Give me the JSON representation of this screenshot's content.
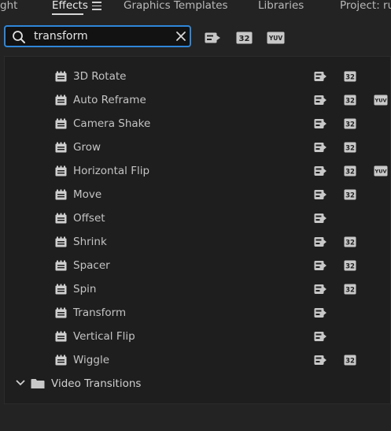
{
  "tabs": [
    {
      "id": "light",
      "label": "ght"
    },
    {
      "id": "effects",
      "label": "Effects"
    },
    {
      "id": "graphics",
      "label": "Graphics Templates"
    },
    {
      "id": "libraries",
      "label": "Libraries"
    },
    {
      "id": "project",
      "label": "Project: ru"
    }
  ],
  "search": {
    "value": "transform",
    "placeholder": ""
  },
  "filters": {
    "accelerated_icon": "accelerated-icon",
    "bit32_label": "32",
    "yuv_label": "YUV"
  },
  "effects": [
    {
      "label": "3D Rotate",
      "accelerated": true,
      "bit32": true,
      "yuv": false
    },
    {
      "label": "Auto Reframe",
      "accelerated": true,
      "bit32": true,
      "yuv": true
    },
    {
      "label": "Camera Shake",
      "accelerated": true,
      "bit32": true,
      "yuv": false
    },
    {
      "label": "Grow",
      "accelerated": true,
      "bit32": true,
      "yuv": false
    },
    {
      "label": "Horizontal Flip",
      "accelerated": true,
      "bit32": true,
      "yuv": true
    },
    {
      "label": "Move",
      "accelerated": true,
      "bit32": true,
      "yuv": false
    },
    {
      "label": "Offset",
      "accelerated": true,
      "bit32": false,
      "yuv": false
    },
    {
      "label": "Shrink",
      "accelerated": true,
      "bit32": true,
      "yuv": false
    },
    {
      "label": "Spacer",
      "accelerated": true,
      "bit32": true,
      "yuv": false
    },
    {
      "label": "Spin",
      "accelerated": true,
      "bit32": true,
      "yuv": false
    },
    {
      "label": "Transform",
      "accelerated": true,
      "bit32": false,
      "yuv": false
    },
    {
      "label": "Vertical Flip",
      "accelerated": true,
      "bit32": false,
      "yuv": false
    },
    {
      "label": "Wiggle",
      "accelerated": true,
      "bit32": true,
      "yuv": false
    }
  ],
  "folders": [
    {
      "label": "Video Transitions",
      "expanded": true
    }
  ],
  "colors": {
    "accent": "#2f86d8",
    "panel": "#1e1e1e",
    "background": "#232323"
  }
}
